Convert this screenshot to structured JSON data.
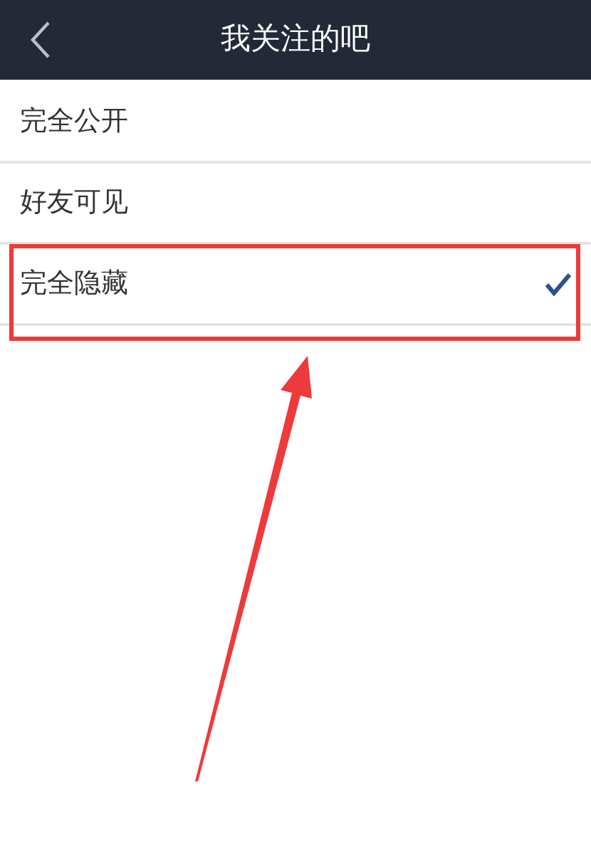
{
  "header": {
    "title": "我关注的吧"
  },
  "options": [
    {
      "label": "完全公开",
      "selected": false
    },
    {
      "label": "好友可见",
      "selected": false
    },
    {
      "label": "完全隐藏",
      "selected": true
    }
  ],
  "annotation": {
    "kind": "box-and-arrow"
  }
}
